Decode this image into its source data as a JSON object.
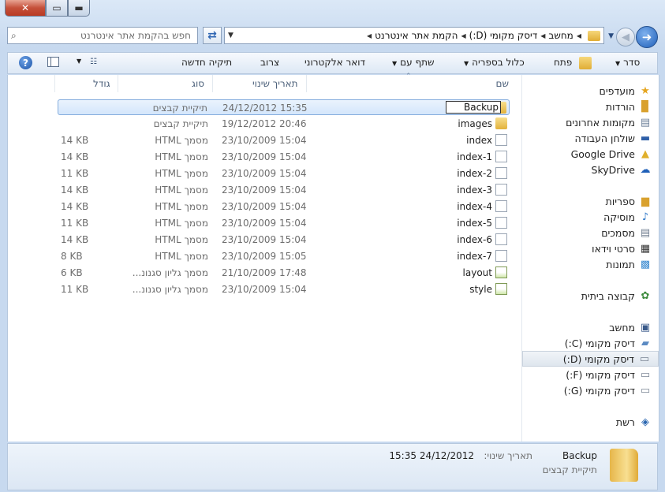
{
  "window": {
    "close_glyph": "✕",
    "max_glyph": "▭",
    "min_glyph": "▬"
  },
  "address": {
    "crumbs": [
      "מחשב",
      "דיסק מקומי (D:)",
      "הקמת אתר אינטרנט"
    ]
  },
  "search": {
    "placeholder": "חפש בהקמת אתר אינטרנט"
  },
  "toolbar": {
    "organize": "סדר",
    "open": "פתח",
    "include_in_library": "כלול בספריה",
    "share_with": "שתף עם",
    "email": "דואר אלקטרוני",
    "burn": "צרוב",
    "new_folder": "תיקיה חדשה"
  },
  "columns": {
    "name": "שם",
    "date": "תאריך שינוי",
    "type": "סוג",
    "size": "גודל"
  },
  "rename_value": "Backup",
  "files": [
    {
      "name": "Backup",
      "date": "24/12/2012 15:35",
      "type": "תיקיית קבצים",
      "size": "",
      "icon": "folder"
    },
    {
      "name": "images",
      "date": "19/12/2012 20:46",
      "type": "תיקיית קבצים",
      "size": "",
      "icon": "folder"
    },
    {
      "name": "index",
      "date": "23/10/2009 15:04",
      "type": "מסמך HTML",
      "size": "14 KB",
      "icon": "html"
    },
    {
      "name": "index-1",
      "date": "23/10/2009 15:04",
      "type": "מסמך HTML",
      "size": "14 KB",
      "icon": "html"
    },
    {
      "name": "index-2",
      "date": "23/10/2009 15:04",
      "type": "מסמך HTML",
      "size": "11 KB",
      "icon": "html"
    },
    {
      "name": "index-3",
      "date": "23/10/2009 15:04",
      "type": "מסמך HTML",
      "size": "14 KB",
      "icon": "html"
    },
    {
      "name": "index-4",
      "date": "23/10/2009 15:04",
      "type": "מסמך HTML",
      "size": "14 KB",
      "icon": "html"
    },
    {
      "name": "index-5",
      "date": "23/10/2009 15:04",
      "type": "מסמך HTML",
      "size": "11 KB",
      "icon": "html"
    },
    {
      "name": "index-6",
      "date": "23/10/2009 15:04",
      "type": "מסמך HTML",
      "size": "14 KB",
      "icon": "html"
    },
    {
      "name": "index-7",
      "date": "23/10/2009 15:05",
      "type": "מסמך HTML",
      "size": "8 KB",
      "icon": "html"
    },
    {
      "name": "layout",
      "date": "21/10/2009 17:48",
      "type": "מסמך גליון סגנונ...",
      "size": "6 KB",
      "icon": "css"
    },
    {
      "name": "style",
      "date": "23/10/2009 15:04",
      "type": "מסמך גליון סגנונ...",
      "size": "11 KB",
      "icon": "css"
    }
  ],
  "nav": {
    "favorites": "מועדפים",
    "downloads": "הורדות",
    "recent": "מקומות אחרונים",
    "desktop": "שולחן העבודה",
    "google_drive": "Google Drive",
    "skydrive": "SkyDrive",
    "libraries": "ספריות",
    "music": "מוסיקה",
    "documents": "מסמכים",
    "videos": "סרטי וידאו",
    "pictures": "תמונות",
    "homegroup": "קבוצה ביתית",
    "computer": "מחשב",
    "drive_c": "דיסק מקומי (C:)",
    "drive_d": "דיסק מקומי (D:)",
    "drive_f": "דיסק מקומי (F:)",
    "drive_g": "דיסק מקומי (G:)",
    "network": "רשת"
  },
  "details": {
    "name": "Backup",
    "date_label": "תאריך שינוי:",
    "date_value": "24/12/2012 15:35",
    "type": "תיקיית קבצים"
  }
}
